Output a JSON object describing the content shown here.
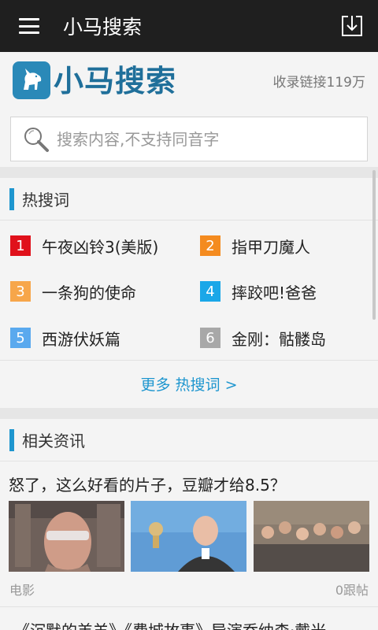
{
  "topbar": {
    "title": "小马搜索",
    "menu_icon": "hamburger-menu-icon",
    "download_icon": "download-icon"
  },
  "header": {
    "logo_text": "小马搜索",
    "logo_icon": "unicorn-logo-icon",
    "index_count": "收录链接119万"
  },
  "search": {
    "placeholder": "搜索内容,不支持同音字",
    "value": "",
    "icon": "magnifier-icon"
  },
  "hot_section": {
    "title": "热搜词",
    "items": [
      {
        "rank": "1",
        "keyword": "午夜凶铃3(美版)",
        "color": "#e0111b"
      },
      {
        "rank": "2",
        "keyword": "指甲刀魔人",
        "color": "#f48b1f"
      },
      {
        "rank": "3",
        "keyword": "一条狗的使命",
        "color": "#f7a64a"
      },
      {
        "rank": "4",
        "keyword": "摔跤吧!爸爸",
        "color": "#1aa7e8"
      },
      {
        "rank": "5",
        "keyword": "西游伏妖篇",
        "color": "#5aa9ee"
      },
      {
        "rank": "6",
        "keyword": "金刚：骷髅岛",
        "color": "#a8a8a8"
      }
    ],
    "more_label": "更多 热搜词 >"
  },
  "news_section": {
    "title": "相关资讯",
    "articles": [
      {
        "title": "怒了，这么好看的片子，豆瓣才给8.5？",
        "category": "电影",
        "replies": "0跟帖"
      },
      {
        "title": "《沉默的羔羊》《费城故事》导演乔纳森·戴米"
      }
    ]
  },
  "colors": {
    "accent": "#1e96cf",
    "topbar": "#1f1f1f",
    "brand": "#1f6f9a"
  }
}
